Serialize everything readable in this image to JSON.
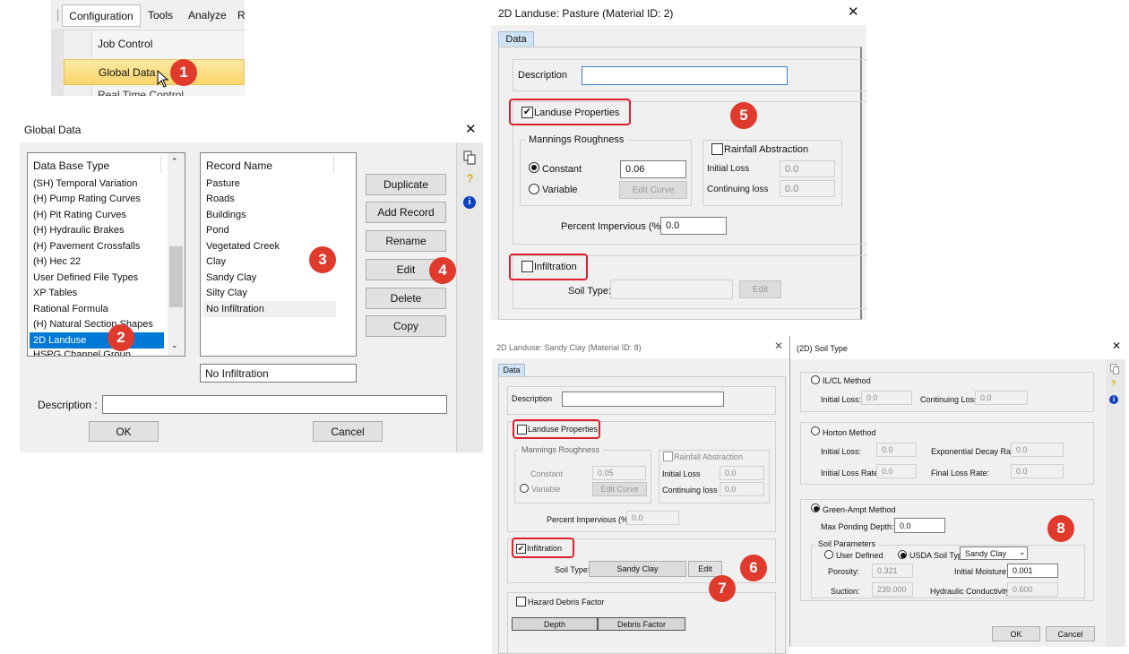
{
  "menu": {
    "items": [
      "Configuration",
      "Tools",
      "Analyze",
      "R"
    ],
    "dropdown": [
      "Job Control",
      "Global Data",
      "Real Time Control"
    ]
  },
  "global_data": {
    "title": "Global Data",
    "close": "✕",
    "db_header": "Data Base Type",
    "db_items": [
      "(SH) Temporal Variation",
      "(H) Pump Rating Curves",
      "(H) Pit Rating Curves",
      "(H) Hydraulic Brakes",
      "(H) Pavement Crossfalls",
      "(H) Hec 22",
      "User Defined File Types",
      "XP Tables",
      "Rational Formula",
      "(H) Natural Section Shapes",
      "2D Landuse",
      "HSPG Channel Group"
    ],
    "record_header": "Record Name",
    "records": [
      "Pasture",
      "Roads",
      "Buildings",
      "Pond",
      "Vegetated Creek",
      "Clay",
      "Sandy Clay",
      "Silty Clay",
      "No Infiltration"
    ],
    "buttons": [
      "Duplicate",
      "Add Record",
      "Rename",
      "Edit",
      "Delete",
      "Copy"
    ],
    "record_field": "No Infiltration",
    "description_label": "Description :",
    "description_value": "",
    "ok": "OK",
    "cancel": "Cancel"
  },
  "pasture": {
    "title": "2D Landuse: Pasture (Material ID: 2)",
    "close": "✕",
    "tab": "Data",
    "description_label": "Description",
    "landuse_label": "Landuse Properties",
    "mannings_label": "Mannings Roughness",
    "constant_label": "Constant",
    "constant_value": "0.06",
    "variable_label": "Variable",
    "edit_curve": "Edit Curve",
    "rainfall_label": "Rainfall Abstraction",
    "initial_loss_label": "Initial Loss",
    "initial_loss_value": "0.0",
    "continuing_loss_label": "Continuing loss",
    "continuing_loss_value": "0.0",
    "percent_impervious_label": "Percent Impervious (%):",
    "percent_impervious_value": "0.0",
    "infiltration_label": "Infiltration",
    "soil_type_label": "Soil Type:",
    "edit": "Edit"
  },
  "sandy": {
    "title": "2D Landuse: Sandy Clay (Material ID: 8)",
    "close": "✕",
    "tab": "Data",
    "description_label": "Description",
    "landuse_label": "Landuse Properties",
    "mannings_label": "Mannings Roughness",
    "constant_label": "Constant",
    "constant_value": "0.05",
    "variable_label": "Variable",
    "edit_curve": "Edit Curve",
    "rainfall_label": "Rainfall Abstraction",
    "initial_loss_label": "Initial Loss",
    "initial_loss_value": "0.0",
    "continuing_loss_label": "Continuing loss",
    "continuing_loss_value": "0.0",
    "percent_impervious_label": "Percent Impervious (%):",
    "percent_impervious_value": "0.0",
    "infiltration_label": "Infiltration",
    "soil_type_label": "Soil Type:",
    "soil_type_value": "Sandy Clay",
    "edit": "Edit",
    "hazard_label": "Hazard Debris Factor",
    "depth_header": "Depth",
    "debris_header": "Debris Factor"
  },
  "soil": {
    "title": "(2D) Soil Type",
    "close": "✕",
    "ilcl_label": "IL/CL Method",
    "initial_loss_label": "Initial Loss:",
    "initial_loss_value": "0.0",
    "continuing_loss_label": "Continuing Loss:",
    "continuing_loss_value": "0.0",
    "horton_label": "Horton Method",
    "h_initial_loss_label": "Initial Loss:",
    "h_initial_loss_value": "0.0",
    "decay_label": "Exponential Decay Rate:",
    "decay_value": "0.0",
    "initial_loss_rate_label": "Initial Loss Rate:",
    "initial_loss_rate_value": "0.0",
    "final_loss_rate_label": "Final Loss Rate:",
    "final_loss_rate_value": "0.0",
    "green_ampt_label": "Green-Ampt Method",
    "max_ponding_label": "Max Ponding Depth:",
    "max_ponding_value": "0.0",
    "soil_params_label": "Soil Parameters",
    "user_defined_label": "User Defined",
    "usda_label": "USDA Soil Type",
    "usda_value": "Sandy Clay",
    "porosity_label": "Porosity:",
    "porosity_value": "0.321",
    "initial_moisture_label": "Initial Moisture:",
    "initial_moisture_value": "0.001",
    "suction_label": "Suction:",
    "suction_value": "239.000",
    "hydraulic_label": "Hydraulic Conductivity:",
    "hydraulic_value": "0.600",
    "ok": "OK",
    "cancel": "Cancel"
  },
  "badges": [
    "1",
    "2",
    "3",
    "4",
    "5",
    "6",
    "7",
    "8"
  ],
  "colors": {
    "badge": "#e03a2c",
    "highlight_box": "#e0202a",
    "selection": "#0078d7",
    "tab": "#cfe3f5"
  }
}
